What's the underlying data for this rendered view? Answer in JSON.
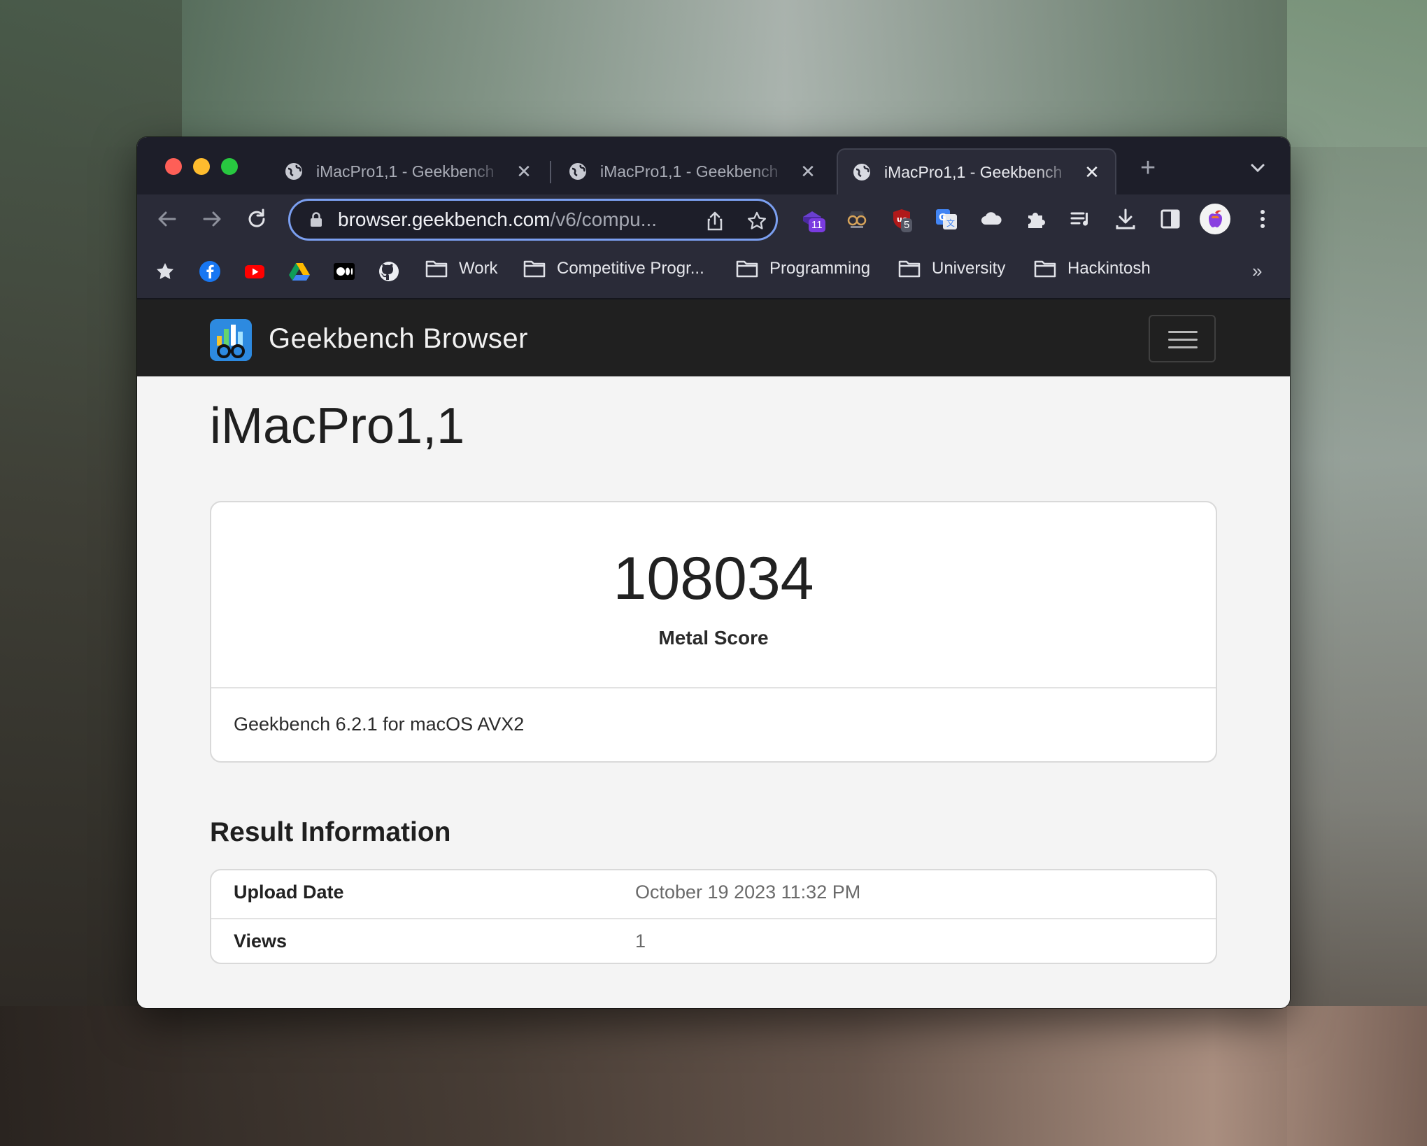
{
  "browser": {
    "tabs": [
      {
        "label": "iMacPro1,1 - Geekbench",
        "active": false
      },
      {
        "label": "iMacPro1,1 - Geekbench",
        "active": false
      },
      {
        "label": "iMacPro1,1 - Geekbench",
        "active": true
      }
    ],
    "url_host": "browser.geekbench.com",
    "url_path": "/v6/compu...",
    "extension_badges": {
      "first": "11",
      "ublock": "5"
    },
    "bookmarks": {
      "folders": [
        "Work",
        "Competitive Progr...",
        "Programming",
        "University",
        "Hackintosh"
      ],
      "more": "»"
    }
  },
  "site": {
    "brand": "Geekbench Browser"
  },
  "page": {
    "title": "iMacPro1,1",
    "score": {
      "value": "108034",
      "label": "Metal Score",
      "version": "Geekbench 6.2.1 for macOS AVX2"
    },
    "result_info": {
      "heading": "Result Information",
      "rows": [
        {
          "key": "Upload Date",
          "value": "October 19 2023 11:32 PM"
        },
        {
          "key": "Views",
          "value": "1"
        }
      ]
    }
  },
  "colors": {
    "tab_strip": "#1d1e29",
    "toolbar": "#2a2b38",
    "omnibox_focus": "#7b9ff0",
    "site_nav": "#202020",
    "page_bg": "#f4f4f4"
  }
}
